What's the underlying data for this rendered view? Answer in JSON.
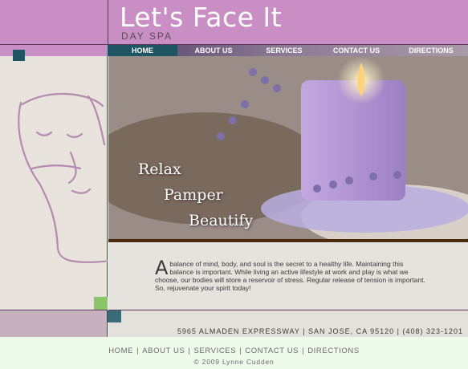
{
  "header": {
    "title": "Let's Face It",
    "subtitle": "DAY SPA"
  },
  "nav": {
    "items": [
      {
        "label": "HOME",
        "active": true
      },
      {
        "label": "ABOUT US",
        "active": false
      },
      {
        "label": "SERVICES",
        "active": false
      },
      {
        "label": "CONTACT US",
        "active": false
      },
      {
        "label": "DIRECTIONS",
        "active": false
      }
    ]
  },
  "hero": {
    "taglines": [
      "Relax",
      "Pamper",
      "Beautify"
    ]
  },
  "intro": {
    "dropcap": "A",
    "text": " balance of mind, body, and soul is the secret to a healthy life. Maintaining this balance is important. While living an active lifestyle at work and play is what we choose, our bodies will store a reservoir of stress. Regular release of tension is important. So, rejuvenate your spirit today!"
  },
  "address": "5965 ALMADEN EXPRESSWAY | SAN JOSE, CA 95120 | (408) 323-1201",
  "footer": {
    "links": [
      "HOME",
      "ABOUT US",
      "SERVICES",
      "CONTACT US",
      "DIRECTIONS"
    ],
    "separator": "|",
    "copyright": "© 2009 Lynne Cudden"
  },
  "colors": {
    "accent": "#c98fc4",
    "nav_active": "#1f5563",
    "green": "#8cc46a",
    "footer_bg": "#eefbea"
  }
}
